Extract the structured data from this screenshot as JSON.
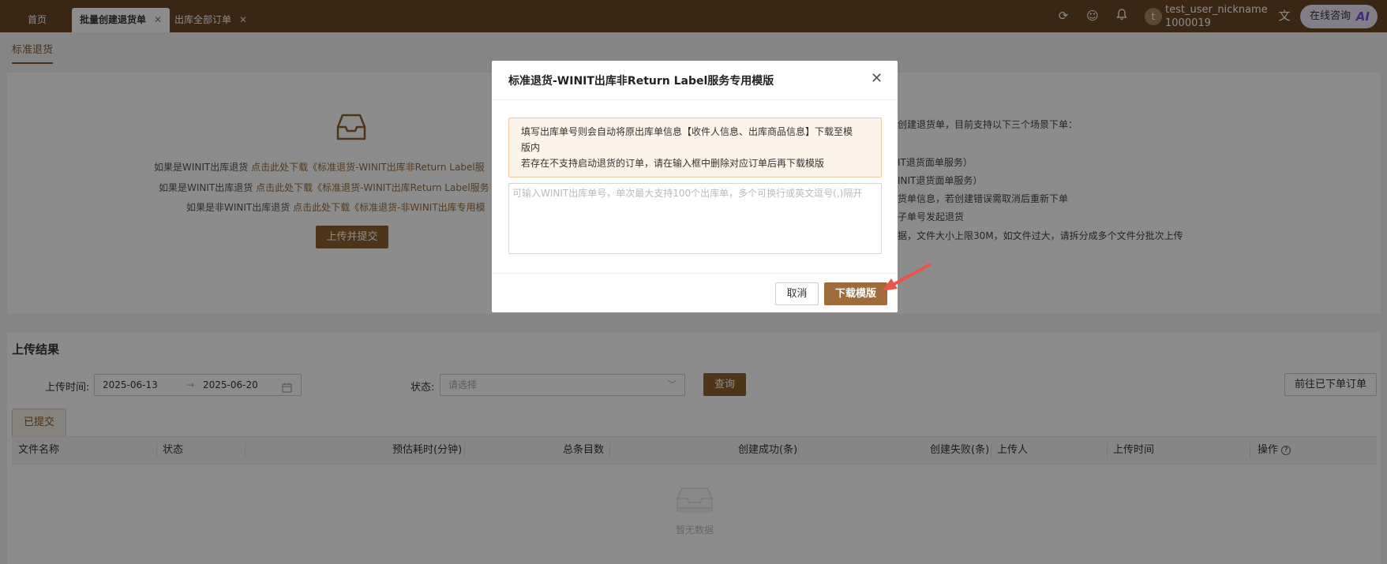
{
  "topbar": {
    "tabs": [
      {
        "label": "首页"
      },
      {
        "label": "批量创建退货单"
      },
      {
        "label": "出库全部订单"
      }
    ],
    "user": {
      "avatar_letter": "t",
      "name": "test_user_nickname",
      "id": "1000019"
    },
    "ai_button": {
      "label": "在线咨询",
      "badge": "AI"
    },
    "icons": [
      "refresh-icon",
      "feedback-icon",
      "bell-icon",
      "translate-icon"
    ]
  },
  "page": {
    "subtab": "标准退货",
    "download_lines": [
      {
        "prefix": "如果是WINIT出库退货",
        "link": "点击此处下载《标准退货-WINIT出库非Return Label服"
      },
      {
        "prefix": "如果是WINIT出库退货",
        "link": "点击此处下载《标准退货-WINIT出库Return Label服务"
      },
      {
        "prefix": "如果是非WINIT出库退货",
        "link": "点击此处下载《标准退货-非WINIT出库专用模"
      }
    ],
    "upload_button": "上传并提交",
    "notes": [
      "创建退货单，目前支持以下三个场景下单：",
      "IT退货面单服务）",
      "INIT退货面单服务）",
      "货单信息，若创建错误需取消后重新下单",
      "子单号发起退货",
      "据，文件大小上限30M，如文件过大，请拆分成多个文件分批次上传"
    ]
  },
  "results": {
    "title": "上传结果",
    "upload_time_label": "上传时间:",
    "date_start": "2025-06-13",
    "date_arrow": "→",
    "date_end": "2025-06-20",
    "status_label": "状态:",
    "status_placeholder": "请选择",
    "query_button": "查询",
    "goto_button": "前往已下单订单",
    "submitted_tab": "已提交",
    "columns": [
      "文件名称",
      "状态",
      "预估耗时(分钟)",
      "总条目数",
      "创建成功(条)",
      "创建失败(条)",
      "上传人",
      "上传时间",
      "操作"
    ],
    "empty_text": "暂无数据"
  },
  "modal": {
    "title": "标准退货-WINIT出库非Return Label服务专用模版",
    "alert_lines": [
      "填写出库单号则会自动将原出库单信息【收件人信息、出库商品信息】下载至模",
      "版内",
      "若存在不支持启动退货的订单，请在输入框中删除对应订单后再下载模版"
    ],
    "textarea_placeholder": "可输入WINIT出库单号，单次最大支持100个出库单，多个可换行或英文逗号(,)隔开",
    "cancel_button": "取消",
    "download_button": "下载模版"
  },
  "colors": {
    "brand": "#6b4522",
    "accent": "#9e6b3a",
    "annotation_arrow": "#e8554a"
  }
}
